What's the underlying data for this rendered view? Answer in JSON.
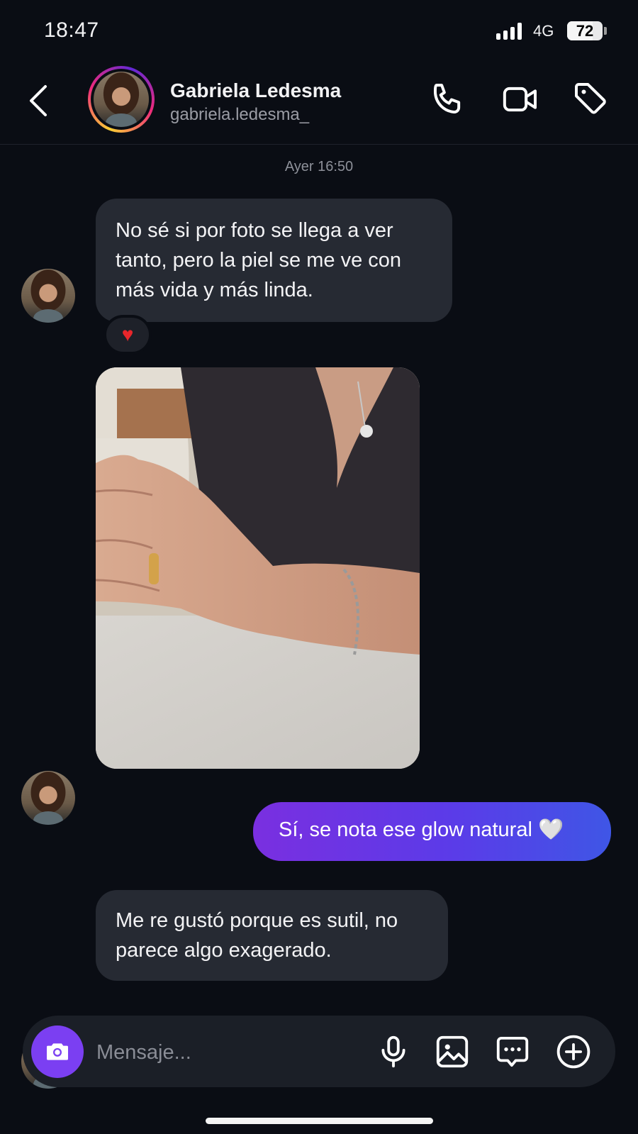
{
  "status_bar": {
    "time": "18:47",
    "network": "4G",
    "battery": "72",
    "battery_level": 0.72
  },
  "header": {
    "back_icon": "chevron-left-icon",
    "contact_name": "Gabriela Ledesma",
    "contact_handle": "gabriela.ledesma_",
    "actions": [
      "phone-icon",
      "video-camera-icon",
      "tag-icon"
    ]
  },
  "conversation": {
    "timestamp": "Ayer 16:50",
    "messages": [
      {
        "from": "contact",
        "type": "text",
        "text": "No sé si por foto se llega a ver tanto, pero la piel se me ve con más vida y más linda.",
        "reaction": "❤️"
      },
      {
        "from": "contact",
        "type": "photo"
      },
      {
        "from": "me",
        "type": "text",
        "text": "Sí, se nota ese glow natural 🤍"
      },
      {
        "from": "contact",
        "type": "text",
        "text": "Me re gustó porque es sutil, no parece algo exagerado."
      }
    ]
  },
  "composer": {
    "placeholder": "Mensaje...",
    "icons": [
      "camera-icon",
      "microphone-icon",
      "gallery-icon",
      "sticker-chat-icon",
      "plus-circle-icon"
    ]
  },
  "colors": {
    "background": "#0a0d14",
    "incoming_bubble": "#262a33",
    "outgoing_gradient_start": "#7a2fe0",
    "outgoing_gradient_end": "#3f56e6",
    "camera_button": "#7b3ff2"
  }
}
